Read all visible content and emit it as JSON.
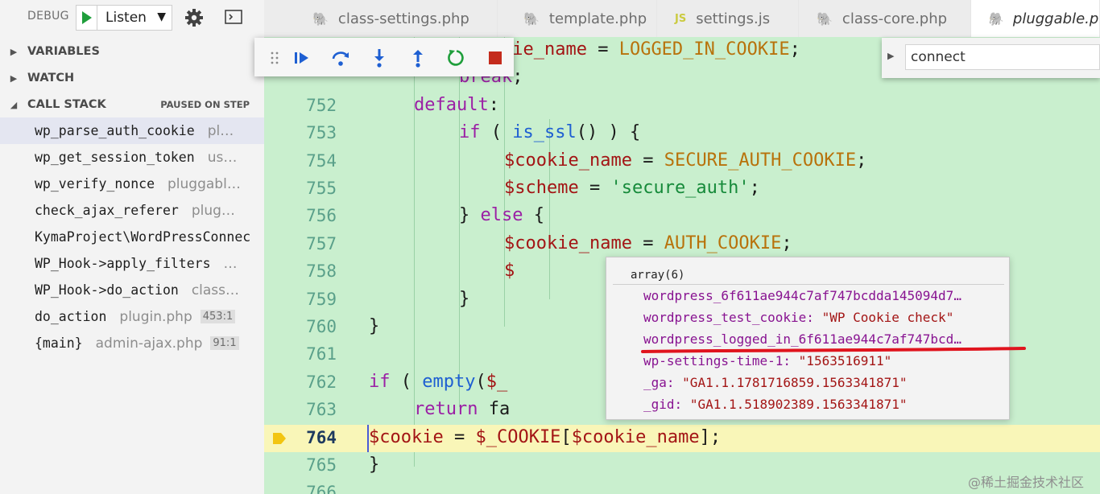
{
  "debug": {
    "label": "DEBUG",
    "config_name": "Listen"
  },
  "sidebar": {
    "sections": {
      "variables": "VARIABLES",
      "watch": "WATCH",
      "call_stack": "CALL STACK",
      "call_stack_status": "PAUSED ON STEP"
    },
    "frames": [
      {
        "fn": "wp_parse_auth_cookie",
        "src": "pl…",
        "line": ""
      },
      {
        "fn": "wp_get_session_token",
        "src": "us…",
        "line": ""
      },
      {
        "fn": "wp_verify_nonce",
        "src": "pluggabl…",
        "line": ""
      },
      {
        "fn": "check_ajax_referer",
        "src": "plug…",
        "line": ""
      },
      {
        "fn": "KymaProject\\WordPressConnec",
        "src": "",
        "line": ""
      },
      {
        "fn": "WP_Hook->apply_filters",
        "src": "…",
        "line": ""
      },
      {
        "fn": "WP_Hook->do_action",
        "src": "class…",
        "line": ""
      },
      {
        "fn": "do_action",
        "src": "plugin.php",
        "line": "453:1"
      },
      {
        "fn": "{main}",
        "src": "admin-ajax.php",
        "line": "91:1"
      }
    ]
  },
  "tabs": [
    {
      "label": "class-settings.php",
      "icon": "php"
    },
    {
      "label": "template.php",
      "icon": "php"
    },
    {
      "label": "settings.js",
      "icon": "js"
    },
    {
      "label": "class-core.php",
      "icon": "php"
    },
    {
      "label": "pluggable.php",
      "icon": "php",
      "active": true
    }
  ],
  "find": {
    "query": "connect"
  },
  "editor": {
    "lines": [
      {
        "num": "",
        "tokens": [
          [
            "var",
            "$cookie_name"
          ],
          [
            "plain",
            " = "
          ],
          [
            "const",
            "LOGGED_IN_COOKIE"
          ],
          [
            "plain",
            ";"
          ]
        ],
        "indent": 3
      },
      {
        "num": "",
        "tokens": [
          [
            "kw",
            "break"
          ],
          [
            "plain",
            ";"
          ]
        ],
        "indent": 3
      },
      {
        "num": "752",
        "tokens": [
          [
            "kw",
            "default"
          ],
          [
            "plain",
            ":"
          ]
        ],
        "indent": 2
      },
      {
        "num": "753",
        "tokens": [
          [
            "kw",
            "if"
          ],
          [
            "plain",
            " ( "
          ],
          [
            "fn",
            "is_ssl"
          ],
          [
            "plain",
            "() ) {"
          ]
        ],
        "indent": 3
      },
      {
        "num": "754",
        "tokens": [
          [
            "var",
            "$cookie_name"
          ],
          [
            "plain",
            " = "
          ],
          [
            "const",
            "SECURE_AUTH_COOKIE"
          ],
          [
            "plain",
            ";"
          ]
        ],
        "indent": 4
      },
      {
        "num": "755",
        "tokens": [
          [
            "var",
            "$scheme"
          ],
          [
            "plain",
            " = "
          ],
          [
            "str",
            "'secure_auth'"
          ],
          [
            "plain",
            ";"
          ]
        ],
        "indent": 4
      },
      {
        "num": "756",
        "tokens": [
          [
            "plain",
            "} "
          ],
          [
            "kw",
            "else"
          ],
          [
            "plain",
            " {"
          ]
        ],
        "indent": 3
      },
      {
        "num": "757",
        "tokens": [
          [
            "var",
            "$cookie_name"
          ],
          [
            "plain",
            " = "
          ],
          [
            "const",
            "AUTH_COOKIE"
          ],
          [
            "plain",
            ";"
          ]
        ],
        "indent": 4
      },
      {
        "num": "758",
        "tokens": [
          [
            "var",
            "$"
          ]
        ],
        "indent": 4
      },
      {
        "num": "759",
        "tokens": [
          [
            "plain",
            "}"
          ]
        ],
        "indent": 3
      },
      {
        "num": "760",
        "tokens": [
          [
            "plain",
            "}"
          ]
        ],
        "indent": 1
      },
      {
        "num": "761",
        "tokens": [],
        "indent": 0
      },
      {
        "num": "762",
        "tokens": [
          [
            "kw",
            "if"
          ],
          [
            "plain",
            " ( "
          ],
          [
            "fn",
            "empty"
          ],
          [
            "plain",
            "("
          ],
          [
            "var",
            "$_"
          ]
        ],
        "indent": 1
      },
      {
        "num": "763",
        "tokens": [
          [
            "kw",
            "return"
          ],
          [
            "plain",
            " fa"
          ]
        ],
        "indent": 2
      },
      {
        "num": "764",
        "tokens": [
          [
            "var",
            "$cookie"
          ],
          [
            "plain",
            " = "
          ],
          [
            "var",
            "$_COOKIE"
          ],
          [
            "plain",
            "["
          ],
          [
            "var",
            "$cookie_name"
          ],
          [
            "plain",
            "];"
          ]
        ],
        "indent": 1,
        "current": true
      },
      {
        "num": "765",
        "tokens": [
          [
            "plain",
            "}"
          ]
        ],
        "indent": 0
      },
      {
        "num": "766",
        "tokens": [],
        "indent": 0
      }
    ]
  },
  "hover": {
    "title": "array(6)",
    "entries": [
      {
        "key": "wordpress_6f611ae944c7af747bcdda145094d7…",
        "value": ""
      },
      {
        "key": "wordpress_test_cookie:",
        "value": "\"WP Cookie check\""
      },
      {
        "key": "wordpress_logged_in_6f611ae944c7af747bcd…",
        "value": ""
      },
      {
        "key": "wp-settings-time-1:",
        "value": "\"1563516911\""
      },
      {
        "key": "_ga:",
        "value": "\"GA1.1.1781716859.1563341871\""
      },
      {
        "key": "_gid:",
        "value": "\"GA1.1.518902389.1563341871\""
      }
    ]
  },
  "watermark": "@稀土掘金技术社区",
  "colors": {
    "editor_bg": "#c9efce",
    "current_line_bg": "#f9f6b8",
    "accent_green": "#1f9e3b",
    "accent_blue": "#1e5fd2",
    "stop_red": "#c42b1c",
    "underline_red": "#e0141e"
  }
}
